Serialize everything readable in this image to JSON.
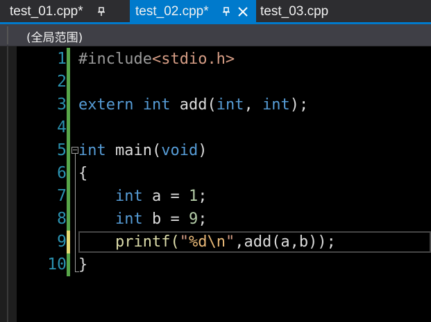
{
  "tabs": [
    {
      "label": "test_01.cpp*",
      "pinned": true,
      "active": false
    },
    {
      "label": "test_02.cpp*",
      "pinned": true,
      "active": true,
      "closable": true
    },
    {
      "label": "test_03.cpp",
      "pinned": false,
      "active": false
    }
  ],
  "scope": {
    "label": "(全局范围)"
  },
  "editor": {
    "line_numbers": [
      "1",
      "2",
      "3",
      "4",
      "5",
      "6",
      "7",
      "8",
      "9",
      "10"
    ],
    "current_line": 9,
    "code": {
      "l1": {
        "a": "#include",
        "b": "<stdio.h>"
      },
      "l3": {
        "a": "extern",
        "b": " ",
        "c": "int",
        "d": " add(",
        "e": "int",
        "f": ", ",
        "g": "int",
        "h": ");"
      },
      "l5": {
        "a": "int",
        "b": " main(",
        "c": "void",
        "d": ")"
      },
      "l6": {
        "a": "{"
      },
      "l7": {
        "a": "    ",
        "b": "int",
        "c": " a = ",
        "d": "1",
        "e": ";"
      },
      "l8": {
        "a": "    ",
        "b": "int",
        "c": " b = ",
        "d": "9",
        "e": ";"
      },
      "l9": {
        "a": "    printf(",
        "b": "\"",
        "c": "%d",
        "d": "\\n",
        "e": "\"",
        "f": ",add(a,b));"
      },
      "l10": {
        "a": "}"
      }
    }
  },
  "colors": {
    "accent": "#007acc",
    "keyword": "#569cd6",
    "line_number": "#2b91af",
    "change_saved": "#57a64a",
    "change_unsaved": "#e6db74"
  }
}
